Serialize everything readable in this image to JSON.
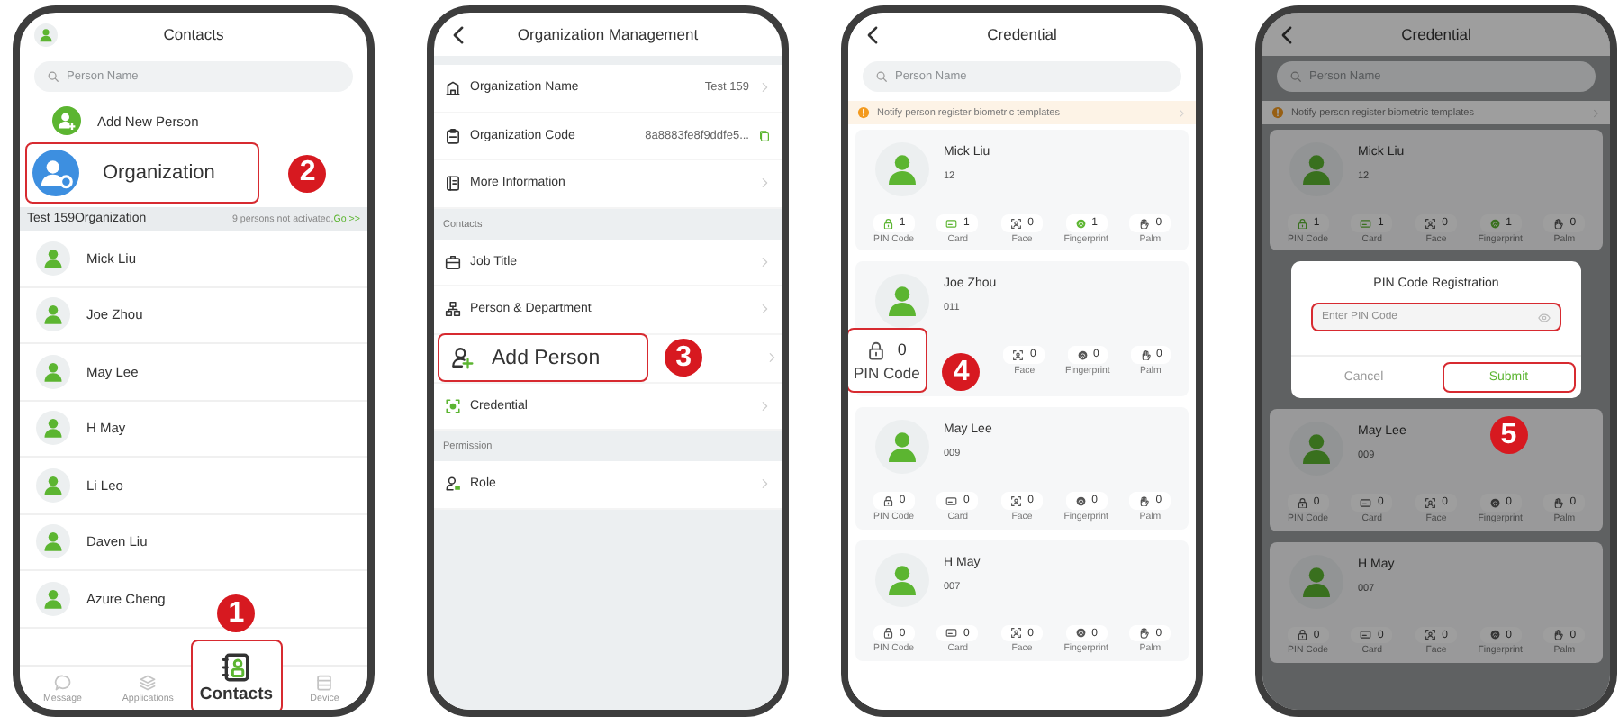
{
  "phones": [
    {
      "kind": "contacts",
      "title": "Contacts",
      "search": {
        "placeholder": "Person Name"
      },
      "add_person": {
        "label": "Add New Person"
      },
      "organization": {
        "label": "Organization",
        "highlighted": true,
        "step": "2"
      },
      "group": {
        "name": "Test 159Organization",
        "notice": "9 persons not activated,",
        "link": "Go >>"
      },
      "people": [
        "Mick Liu",
        "Joe Zhou",
        "May Lee",
        "H May",
        "Li Leo",
        "Daven Liu",
        "Azure Cheng"
      ],
      "tabs": [
        {
          "kind": "message",
          "label": "Message",
          "selected": false,
          "highlighted": false
        },
        {
          "kind": "applications",
          "label": "Applications",
          "selected": false,
          "highlighted": false
        },
        {
          "kind": "contacts",
          "label": "Contacts",
          "selected": true,
          "highlighted": true,
          "step": "1"
        },
        {
          "kind": "device",
          "label": "Device",
          "selected": false,
          "highlighted": false
        }
      ]
    },
    {
      "kind": "organization",
      "title": "Organization Management",
      "sections": [
        {
          "items": [
            {
              "kind": "building",
              "label": "Organization Name",
              "value": "Test 159",
              "copyable": false,
              "highlighted": false
            },
            {
              "kind": "clipboard",
              "label": "Organization Code",
              "value": "8a8883fe8f9ddfe5...",
              "copyable": true,
              "highlighted": false
            },
            {
              "kind": "document",
              "label": "More Information",
              "copyable": false,
              "highlighted": false
            }
          ]
        },
        {
          "label": "Contacts",
          "items": [
            {
              "kind": "briefcase",
              "label": "Job Title",
              "copyable": false,
              "highlighted": false
            },
            {
              "kind": "hierarchy",
              "label": "Person & Department",
              "copyable": false,
              "highlighted": false
            },
            {
              "kind": "person-add",
              "label": "Add Person",
              "copyable": false,
              "highlighted": true,
              "step": "3"
            },
            {
              "kind": "scan",
              "label": "Credential",
              "copyable": false,
              "highlighted": false
            }
          ]
        },
        {
          "label": "Permission",
          "items": [
            {
              "kind": "role",
              "label": "Role",
              "copyable": false,
              "highlighted": false
            }
          ]
        }
      ]
    },
    {
      "kind": "credential",
      "title": "Credential",
      "dimmed": false,
      "search": {
        "placeholder": "Person Name"
      },
      "notice": "Notify person register biometric templates",
      "cards": [
        {
          "kind": "person",
          "name": "Mick Liu",
          "number": "12",
          "stats": [
            {
              "kind": "pin",
              "count": "1",
              "label": "PIN Code",
              "registered": true,
              "highlighted": false
            },
            {
              "kind": "card",
              "count": "1",
              "label": "Card",
              "registered": true,
              "highlighted": false
            },
            {
              "kind": "face",
              "count": "0",
              "label": "Face",
              "registered": false,
              "highlighted": false
            },
            {
              "kind": "fingerprint",
              "count": "1",
              "label": "Fingerprint",
              "registered": true,
              "highlighted": false
            },
            {
              "kind": "palm",
              "count": "0",
              "label": "Palm",
              "registered": false,
              "highlighted": false
            }
          ]
        },
        {
          "kind": "person",
          "name": "Joe Zhou",
          "number": "011",
          "stats": [
            {
              "kind": "pin",
              "count": "0",
              "label": "PIN Code",
              "registered": false,
              "highlighted": true,
              "step": "4"
            },
            {
              "kind": "face",
              "count": "0",
              "label": "Face",
              "registered": false,
              "highlighted": false
            },
            {
              "kind": "fingerprint",
              "count": "0",
              "label": "Fingerprint",
              "registered": false,
              "highlighted": false
            },
            {
              "kind": "palm",
              "count": "0",
              "label": "Palm",
              "registered": false,
              "highlighted": false
            }
          ]
        },
        {
          "kind": "person",
          "name": "May Lee",
          "number": "009",
          "stats": [
            {
              "kind": "pin",
              "count": "0",
              "label": "PIN Code",
              "registered": false,
              "highlighted": false
            },
            {
              "kind": "card",
              "count": "0",
              "label": "Card",
              "registered": false,
              "highlighted": false
            },
            {
              "kind": "face",
              "count": "0",
              "label": "Face",
              "registered": false,
              "highlighted": false
            },
            {
              "kind": "fingerprint",
              "count": "0",
              "label": "Fingerprint",
              "registered": false,
              "highlighted": false
            },
            {
              "kind": "palm",
              "count": "0",
              "label": "Palm",
              "registered": false,
              "highlighted": false
            }
          ]
        },
        {
          "kind": "person",
          "name": "H May",
          "number": "007",
          "stats": [
            {
              "kind": "pin",
              "count": "0",
              "label": "PIN Code",
              "registered": false,
              "highlighted": false
            },
            {
              "kind": "card",
              "count": "0",
              "label": "Card",
              "registered": false,
              "highlighted": false
            },
            {
              "kind": "face",
              "count": "0",
              "label": "Face",
              "registered": false,
              "highlighted": false
            },
            {
              "kind": "fingerprint",
              "count": "0",
              "label": "Fingerprint",
              "registered": false,
              "highlighted": false
            },
            {
              "kind": "palm",
              "count": "0",
              "label": "Palm",
              "registered": false,
              "highlighted": false
            }
          ]
        }
      ]
    },
    {
      "kind": "credential",
      "title": "Credential",
      "dimmed": true,
      "search": {
        "placeholder": "Person Name"
      },
      "notice": "Notify person register biometric templates",
      "cards": [
        {
          "kind": "person",
          "name": "Mick Liu",
          "number": "12",
          "stats": [
            {
              "kind": "pin",
              "count": "1",
              "label": "PIN Code",
              "registered": true,
              "highlighted": false
            },
            {
              "kind": "card",
              "count": "1",
              "label": "Card",
              "registered": true,
              "highlighted": false
            },
            {
              "kind": "face",
              "count": "0",
              "label": "Face",
              "registered": false,
              "highlighted": false
            },
            {
              "kind": "fingerprint",
              "count": "1",
              "label": "Fingerprint",
              "registered": true,
              "highlighted": false
            },
            {
              "kind": "palm",
              "count": "0",
              "label": "Palm",
              "registered": false,
              "highlighted": false
            }
          ]
        },
        {
          "kind": "dialog",
          "title": "PIN Code Registration",
          "input": {
            "placeholder": "Enter PIN Code",
            "highlighted": true
          },
          "buttons": [
            {
              "kind": "cancel",
              "label": "Cancel",
              "highlighted": false
            },
            {
              "kind": "submit",
              "label": "Submit",
              "highlighted": true,
              "step": "5"
            }
          ]
        },
        {
          "kind": "person",
          "name": "May Lee",
          "number": "009",
          "stats": [
            {
              "kind": "pin",
              "count": "0",
              "label": "PIN Code",
              "registered": false,
              "highlighted": false
            },
            {
              "kind": "card",
              "count": "0",
              "label": "Card",
              "registered": false,
              "highlighted": false
            },
            {
              "kind": "face",
              "count": "0",
              "label": "Face",
              "registered": false,
              "highlighted": false
            },
            {
              "kind": "fingerprint",
              "count": "0",
              "label": "Fingerprint",
              "registered": false,
              "highlighted": false
            },
            {
              "kind": "palm",
              "count": "0",
              "label": "Palm",
              "registered": false,
              "highlighted": false
            }
          ]
        },
        {
          "kind": "person",
          "name": "H May",
          "number": "007",
          "stats": [
            {
              "kind": "pin",
              "count": "0",
              "label": "PIN Code",
              "registered": false,
              "highlighted": false
            },
            {
              "kind": "card",
              "count": "0",
              "label": "Card",
              "registered": false,
              "highlighted": false
            },
            {
              "kind": "face",
              "count": "0",
              "label": "Face",
              "registered": false,
              "highlighted": false
            },
            {
              "kind": "fingerprint",
              "count": "0",
              "label": "Fingerprint",
              "registered": false,
              "highlighted": false
            },
            {
              "kind": "palm",
              "count": "0",
              "label": "Palm",
              "registered": false,
              "highlighted": false
            }
          ]
        }
      ]
    }
  ]
}
